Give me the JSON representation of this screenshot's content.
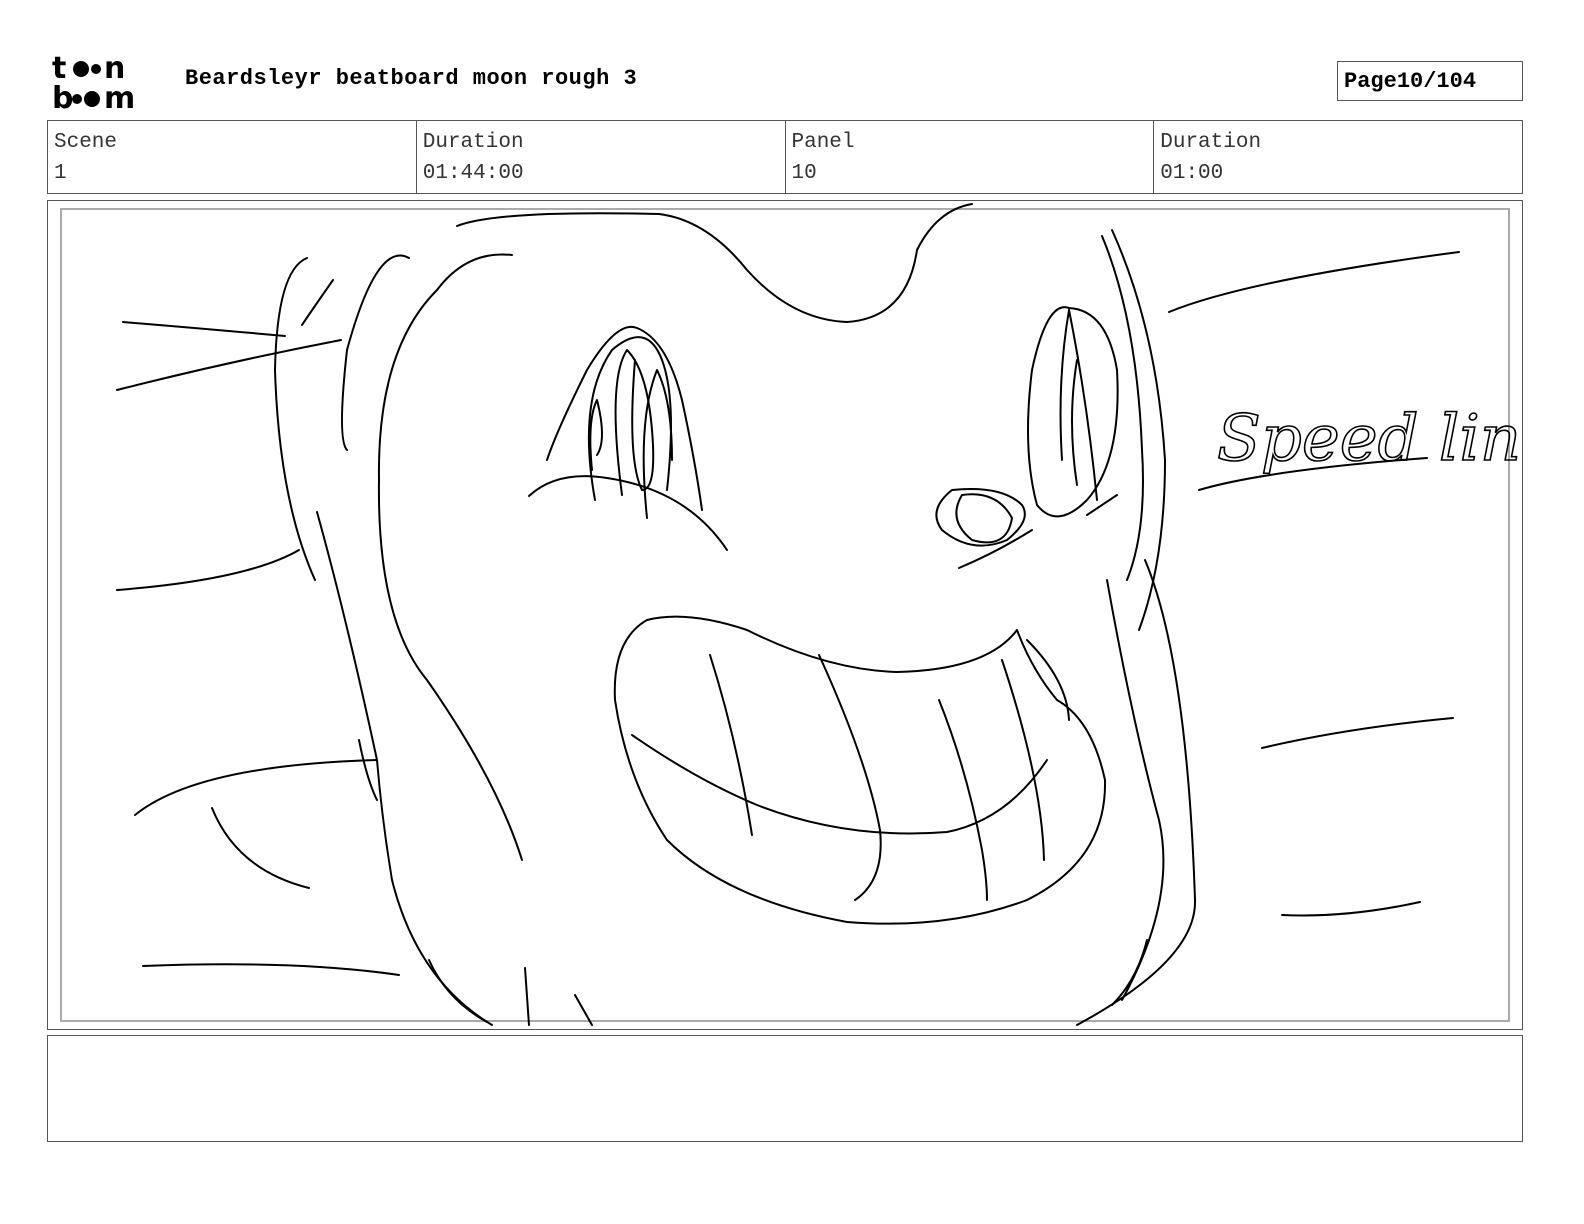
{
  "header": {
    "logo_text": "toon boom",
    "title": "Beardsleyr beatboard moon rough 3",
    "page_label": "Page",
    "page_value": "10/104"
  },
  "info": {
    "scene_label": "Scene",
    "scene_value": "1",
    "scene_duration_label": "Duration",
    "scene_duration_value": "01:44:00",
    "panel_label": "Panel",
    "panel_value": "10",
    "panel_duration_label": "Duration",
    "panel_duration_value": "01:00"
  },
  "panel": {
    "sketch_text": "Speed lines"
  },
  "notes": {
    "text": ""
  }
}
